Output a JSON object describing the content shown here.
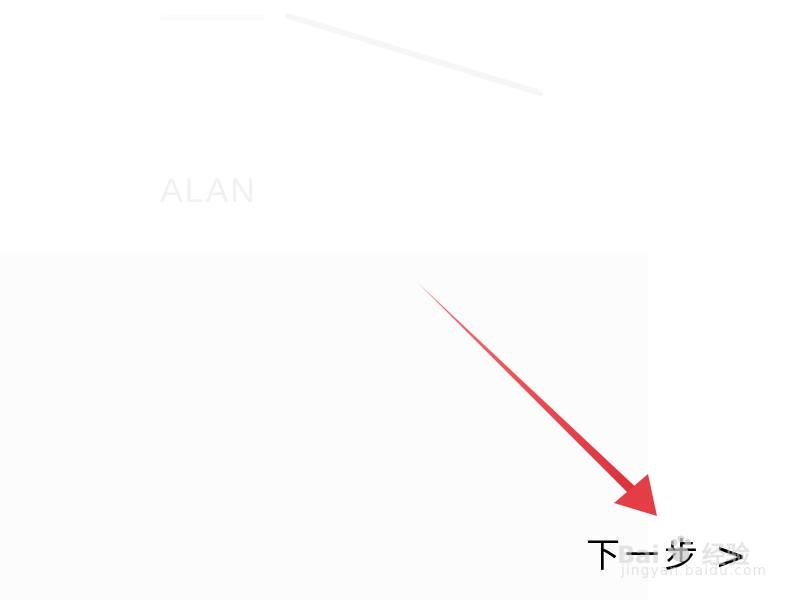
{
  "screen": {
    "background_color": "#ffffff",
    "faint_title": "ALAN"
  },
  "navigation": {
    "next_label": "下一步",
    "next_chevron": ">"
  },
  "annotation": {
    "arrow_color": "#e33d45",
    "arrow_icon": "red-pointing-arrow-icon"
  },
  "watermark": {
    "brand_prefix": "Bai",
    "brand_suffix": "经验",
    "url": "jingyan.baidu.com",
    "icon": "paw-icon"
  }
}
